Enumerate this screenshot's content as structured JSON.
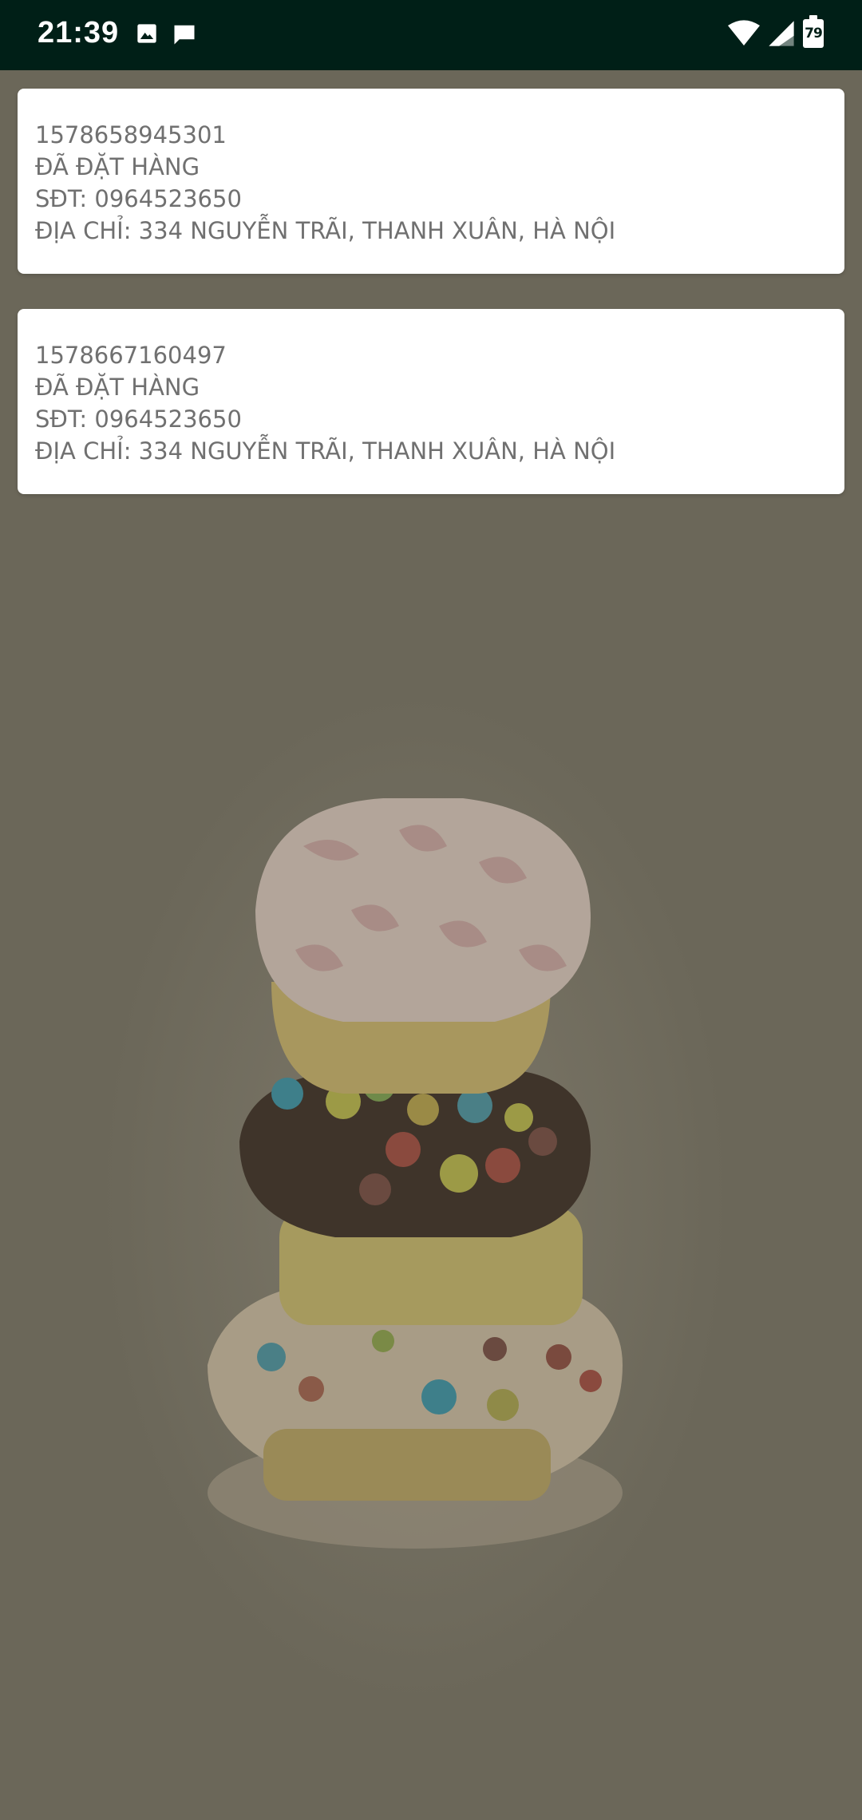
{
  "status_bar": {
    "time": "21:39",
    "battery_level": "79",
    "left_icons": [
      "image-icon",
      "message-icon"
    ],
    "right_icons": [
      "wifi-icon",
      "signal-icon",
      "battery-icon"
    ]
  },
  "orders": [
    {
      "id": "1578658945301",
      "status": "ĐÃ ĐẶT HÀNG",
      "phone": "SĐT: 0964523650",
      "address": "ĐỊA CHỈ: 334 NGUYỄN TRÃI, THANH XUÂN, HÀ NỘI"
    },
    {
      "id": "1578667160497",
      "status": "ĐÃ ĐẶT HÀNG",
      "phone": "SĐT: 0964523650",
      "address": "ĐỊA CHỈ: 334 NGUYỄN TRÃI, THANH XUÂN, HÀ NỘI"
    }
  ],
  "colors": {
    "status_bar": "#001f17",
    "background": "#6b6759",
    "card": "#ffffff",
    "text": "#707070"
  }
}
